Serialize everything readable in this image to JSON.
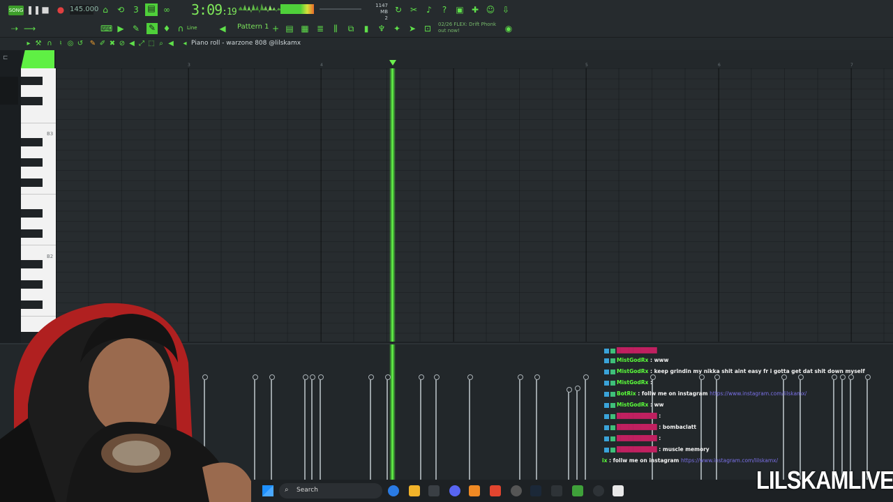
{
  "toolbar": {
    "song_mode": "SONG",
    "tempo": "145.000",
    "time": "3:09",
    "time_ms": "19",
    "memory": "1147 MB",
    "cpu": "2",
    "hint_line1": "02/26  FLEX: Drift Phonk",
    "hint_line2": "out now!",
    "pattern": "Pattern 1",
    "snap": "Line"
  },
  "piano_roll": {
    "title": "Piano roll - warzone 808 @lilskamx",
    "ruler": [
      "3",
      "4",
      "5",
      "6",
      "7"
    ],
    "key_labels": [
      "B3",
      "B2"
    ]
  },
  "chat": [
    {
      "user": "",
      "text": "",
      "color": "red"
    },
    {
      "user": "MistGodRx",
      "text": ": www",
      "color": "green"
    },
    {
      "user": "MistGodRx",
      "text": ": keep grindin my nikka shit aint easy fr i gotta get dat shit down myself",
      "color": "green"
    },
    {
      "user": "MistGodRx",
      "text": ":",
      "color": "green"
    },
    {
      "user": "BotRix",
      "text": ": follw me on instagram ",
      "link": "https://www.instagram.com/lilskamx/",
      "color": "green"
    },
    {
      "user": "MistGodRx",
      "text": ": ww",
      "color": "green"
    },
    {
      "user": "",
      "text": ":",
      "color": "red"
    },
    {
      "user": "",
      "text": ": bombaclatt",
      "color": "red"
    },
    {
      "user": "",
      "text": ":",
      "color": "red"
    },
    {
      "user": "",
      "text": ": muscle memory",
      "color": "red"
    },
    {
      "user": "ix",
      "text": ": follw me on instagram ",
      "link": "https://www.instagram.com/lilskamx/",
      "color": "green"
    }
  ],
  "taskbar": {
    "search": "Search"
  },
  "watermark": "LILSKAMLIVE",
  "colors": {
    "accent": "#5ff044",
    "grid": "#272c2f",
    "playhead": "#52e83a"
  }
}
